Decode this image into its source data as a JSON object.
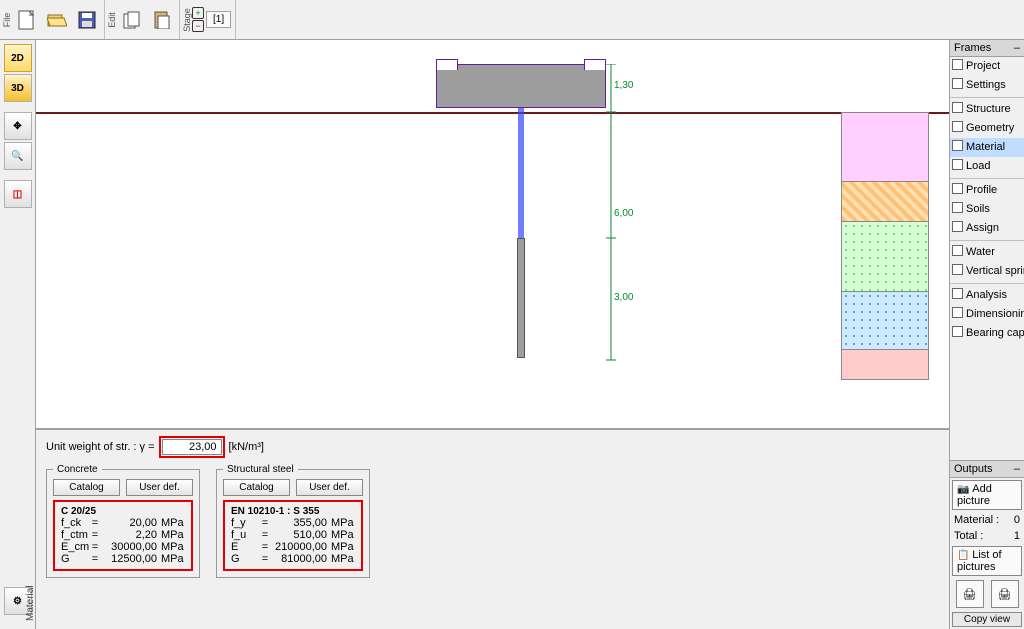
{
  "toolbar": {
    "file_label": "File",
    "edit_label": "Edit",
    "stage_label": "Stage",
    "stage_tag": "[1]"
  },
  "left_tools": {
    "btn2d": "2D",
    "btn3d": "3D"
  },
  "canvas_dims": {
    "d1": "1,30",
    "d2": "6,00",
    "d3": "3,00"
  },
  "right": {
    "head": "Frames",
    "items": [
      "Project",
      "Settings",
      "Structure",
      "Geometry",
      "Material",
      "Load",
      "Profile",
      "Soils",
      "Assign",
      "Water",
      "Vertical springs",
      "Analysis",
      "Dimensioning",
      "Bearing cap."
    ],
    "selected_index": 4
  },
  "outputs": {
    "head": "Outputs",
    "add_btn": "Add picture",
    "material_lbl": "Material :",
    "material_val": "0",
    "total_lbl": "Total :",
    "total_val": "1",
    "list_btn": "List of pictures",
    "copy_view": "Copy view"
  },
  "bottom": {
    "tab_label": "Material",
    "unit_weight_label": "Unit weight of str. :   γ =",
    "unit_weight_value": "23,00",
    "unit_weight_unit": "[kN/m³]",
    "concrete": {
      "legend": "Concrete",
      "catalog": "Catalog",
      "userdef": "User def.",
      "title": "C 20/25",
      "rows": [
        {
          "k": "f_ck",
          "v": "20,00",
          "u": "MPa"
        },
        {
          "k": "f_ctm",
          "v": "2,20",
          "u": "MPa"
        },
        {
          "k": "E_cm",
          "v": "30000,00",
          "u": "MPa"
        },
        {
          "k": "G",
          "v": "12500,00",
          "u": "MPa"
        }
      ]
    },
    "steel": {
      "legend": "Structural steel",
      "catalog": "Catalog",
      "userdef": "User def.",
      "title": "EN 10210-1 : S 355",
      "rows": [
        {
          "k": "f_y",
          "v": "355,00",
          "u": "MPa"
        },
        {
          "k": "f_u",
          "v": "510,00",
          "u": "MPa"
        },
        {
          "k": "E",
          "v": "210000,00",
          "u": "MPa"
        },
        {
          "k": "G",
          "v": "81000,00",
          "u": "MPa"
        }
      ]
    }
  }
}
